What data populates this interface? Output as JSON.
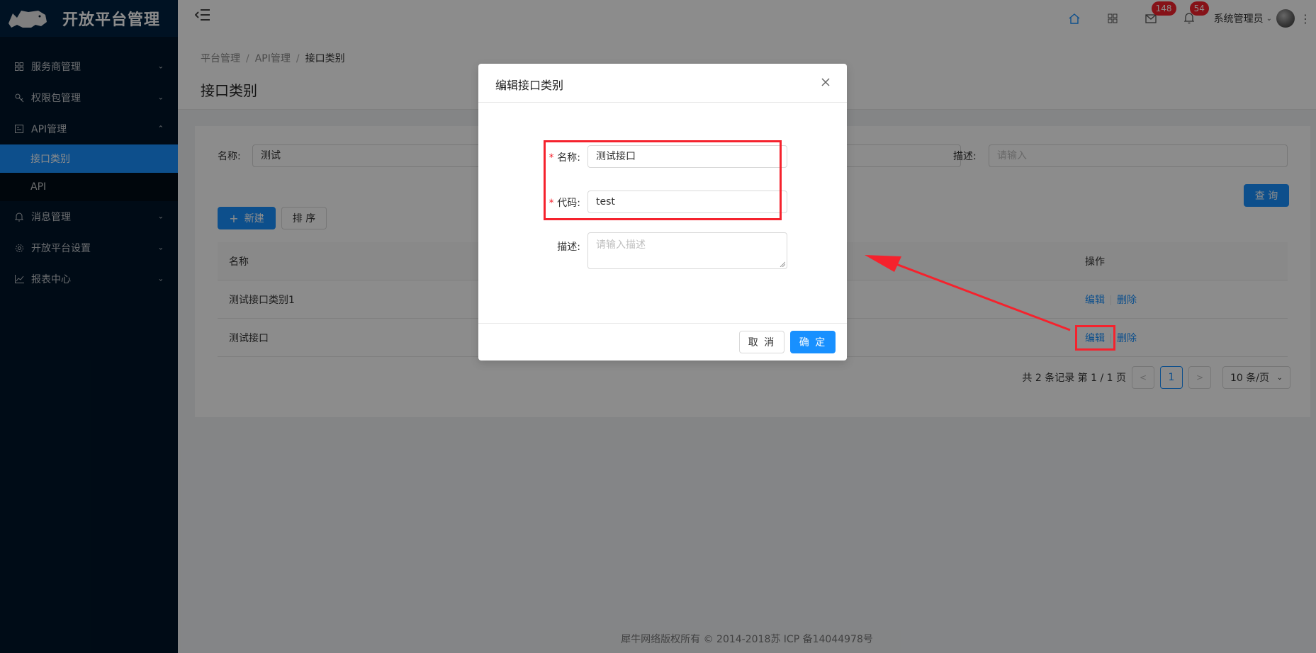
{
  "app": {
    "logo_text": "开放平台管理"
  },
  "sidebar": {
    "items": [
      {
        "label": "服务商管理",
        "icon": "appstore-icon"
      },
      {
        "label": "权限包管理",
        "icon": "key-icon"
      },
      {
        "label": "API管理",
        "icon": "api-icon",
        "expanded": true
      },
      {
        "label": "消息管理",
        "icon": "bell-icon"
      },
      {
        "label": "开放平台设置",
        "icon": "setting-icon"
      },
      {
        "label": "报表中心",
        "icon": "line-chart-icon"
      }
    ],
    "submenu": [
      {
        "label": "接口类别",
        "active": true
      },
      {
        "label": "API",
        "active": false
      }
    ]
  },
  "header": {
    "mail_badge": "148",
    "bell_badge": "54",
    "user_name": "系统管理员"
  },
  "breadcrumb": {
    "items": [
      "平台管理",
      "API管理",
      "接口类别"
    ],
    "separator": "/"
  },
  "page": {
    "title": "接口类别"
  },
  "filters": {
    "name_label": "名称:",
    "name_value": "测试",
    "desc_label": "描述:",
    "desc_placeholder": "请输入",
    "query_button": "查 询",
    "new_button": "新建",
    "sort_button": "排 序"
  },
  "table": {
    "columns": [
      "名称",
      "操作"
    ],
    "rows": [
      {
        "name": "测试接口类别1",
        "edit": "编辑",
        "delete": "删除"
      },
      {
        "name": "测试接口",
        "edit": "编辑",
        "delete": "删除"
      }
    ]
  },
  "pagination": {
    "summary": "共 2 条记录 第 1 / 1 页",
    "current": "1",
    "page_size": "10 条/页"
  },
  "footer": {
    "text": "犀牛网络版权所有 © 2014-2018苏 ICP 备14044978号"
  },
  "modal": {
    "title": "编辑接口类别",
    "name_label": "名称:",
    "name_value": "测试接口",
    "code_label": "代码:",
    "code_value": "test",
    "desc_label": "描述:",
    "desc_placeholder": "请输入描述",
    "cancel": "取 消",
    "ok": "确 定"
  },
  "colors": {
    "primary": "#1890ff",
    "sidebar_bg": "#001529",
    "annotation": "#f5222d"
  }
}
